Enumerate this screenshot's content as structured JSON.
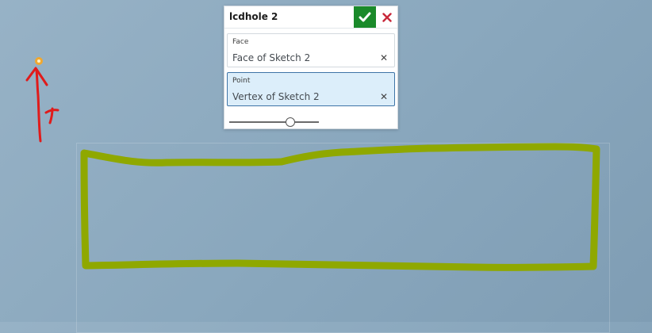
{
  "dialog": {
    "title": "lcdhole 2",
    "accept_icon": "checkmark-icon",
    "cancel_icon": "close-icon",
    "fields": [
      {
        "label": "Face",
        "value": "Face of Sketch 2",
        "active": false
      },
      {
        "label": "Point",
        "value": "Vertex of Sketch 2",
        "active": true
      }
    ],
    "slider": {
      "value_fraction": 0.68
    }
  },
  "annotations": {
    "x_label": "X",
    "stroke_colors": {
      "red": "#e01b1b",
      "green": "#8fa800",
      "point": "#f0a830"
    }
  }
}
